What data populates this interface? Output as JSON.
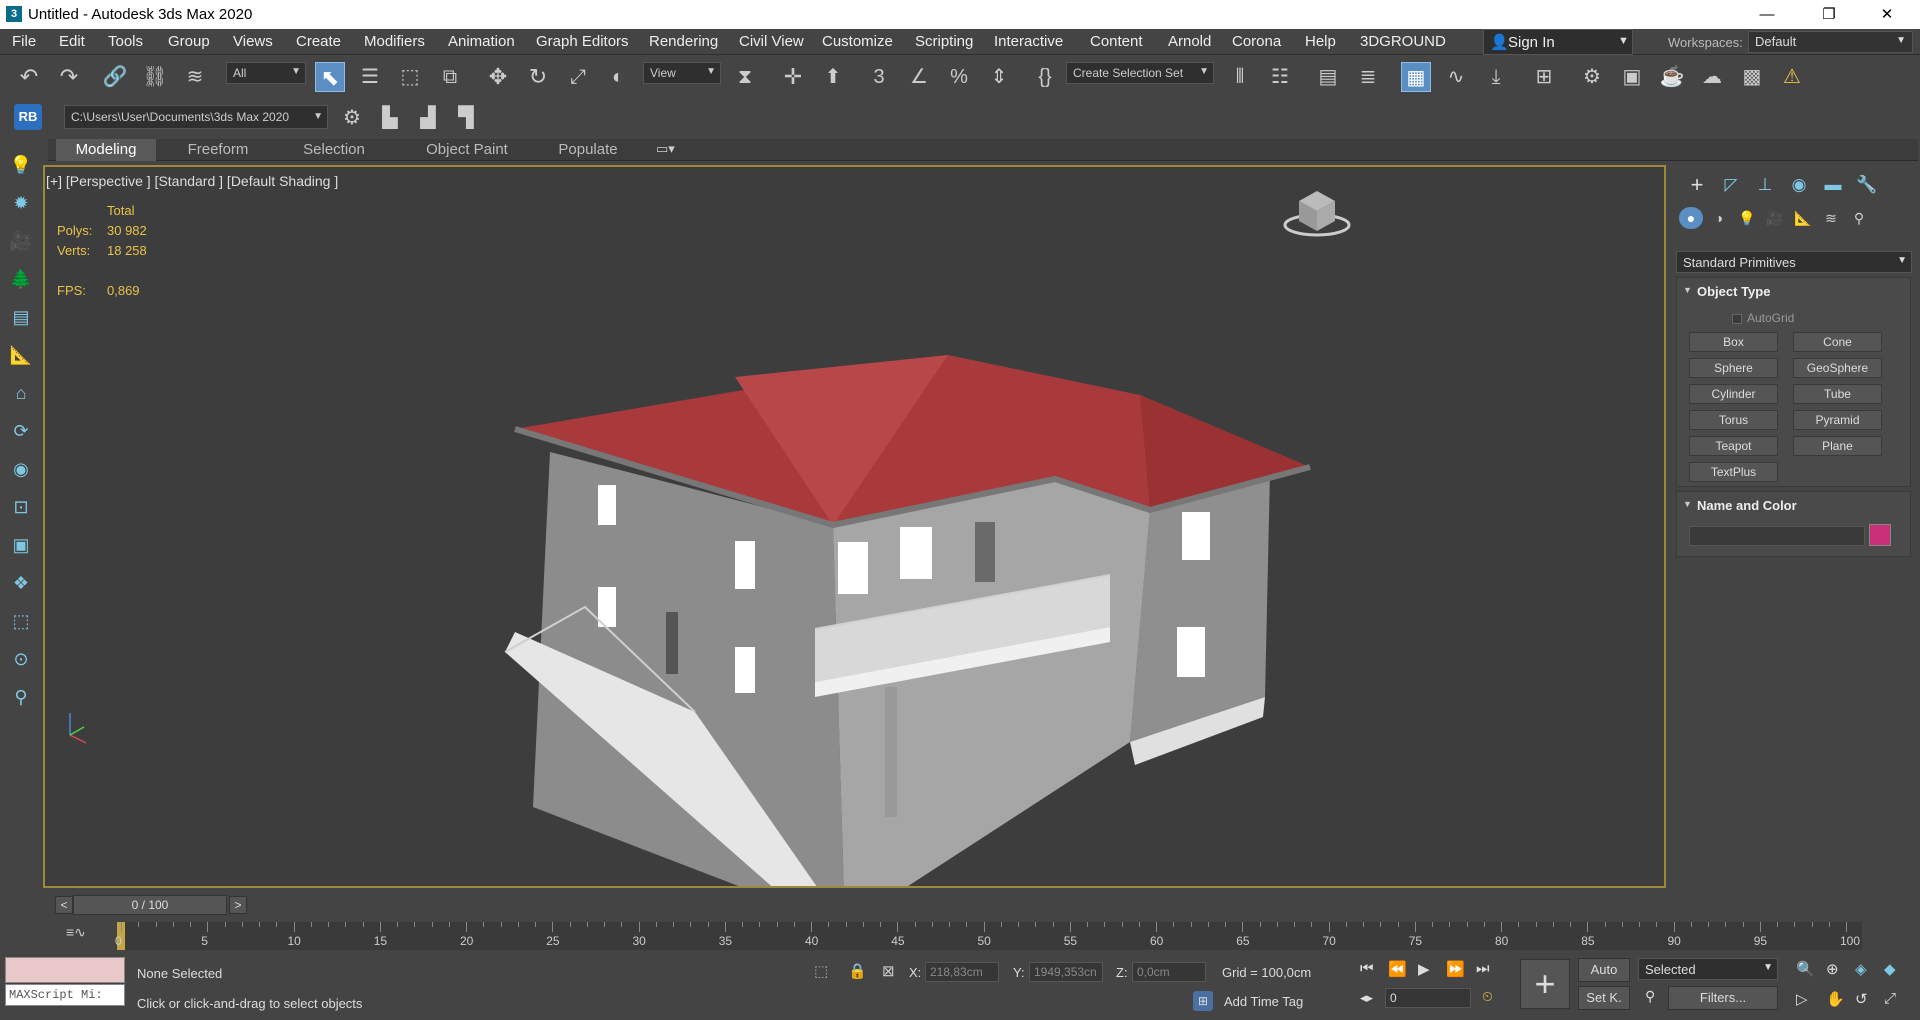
{
  "window": {
    "title": "Untitled - Autodesk 3ds Max 2020",
    "minimize_glyph": "—",
    "maximize_glyph": "❐",
    "close_glyph": "✕"
  },
  "menu": [
    "File",
    "Edit",
    "Tools",
    "Group",
    "Views",
    "Create",
    "Modifiers",
    "Animation",
    "Graph Editors",
    "Rendering",
    "Civil View",
    "Customize",
    "Scripting",
    "Interactive",
    "Content",
    "Arnold",
    "Corona",
    "Help",
    "3DGROUND"
  ],
  "signin": {
    "label": "Sign In"
  },
  "workspace": {
    "label": "Workspaces:",
    "value": "Default"
  },
  "toolbar": {
    "filter_value": "All",
    "refcoord_value": "View",
    "selection_set_value": "Create Selection Set",
    "project_path": "C:\\Users\\User\\Documents\\3ds Max 2020",
    "rb_badge": "RB"
  },
  "ribbon_tabs": [
    "Modeling",
    "Freeform",
    "Selection",
    "Object Paint",
    "Populate"
  ],
  "viewport": {
    "label": "[+] [Perspective ] [Standard ] [Default Shading ]",
    "stats": {
      "total_label": "Total",
      "polys_label": "Polys:",
      "polys_value": "30 982",
      "verts_label": "Verts:",
      "verts_value": "18 258",
      "fps_label": "FPS:",
      "fps_value": "0,869"
    }
  },
  "command_panel": {
    "category_dropdown": "Standard Primitives",
    "object_type_header": "Object Type",
    "autogrid_label": "AutoGrid",
    "object_buttons": [
      "Box",
      "Cone",
      "Sphere",
      "GeoSphere",
      "Cylinder",
      "Tube",
      "Torus",
      "Pyramid",
      "Teapot",
      "Plane",
      "TextPlus"
    ],
    "name_color_header": "Name and Color",
    "object_color": "#c8317a"
  },
  "timeline": {
    "slider_label": "0 / 100",
    "prev_label": "<",
    "next_label": ">",
    "tick_labels": [
      "0",
      "5",
      "10",
      "15",
      "20",
      "25",
      "30",
      "35",
      "40",
      "45",
      "50",
      "55",
      "60",
      "65",
      "70",
      "75",
      "80",
      "85",
      "90",
      "95",
      "100"
    ]
  },
  "status": {
    "selection": "None Selected",
    "prompt": "Click or click-and-drag to select objects",
    "maxscript_placeholder": "MAXScript Mi:",
    "x_label": "X:",
    "x_value": "218,83cm",
    "y_label": "Y:",
    "y_value": "1949,353cn",
    "z_label": "Z:",
    "z_value": "0,0cm",
    "grid": "Grid = 100,0cm",
    "add_time_tag": "Add Time Tag",
    "auto_label": "Auto",
    "setk_label": "Set K.",
    "selected_value": "Selected",
    "filters_label": "Filters...",
    "frame_value": "0"
  },
  "colors": {
    "accent": "#5b8fc4",
    "viewport_border": "#9c8a3a",
    "stats_text": "#e8c24a",
    "roof": "#a83a3c",
    "wall": "#8a8a8a"
  }
}
